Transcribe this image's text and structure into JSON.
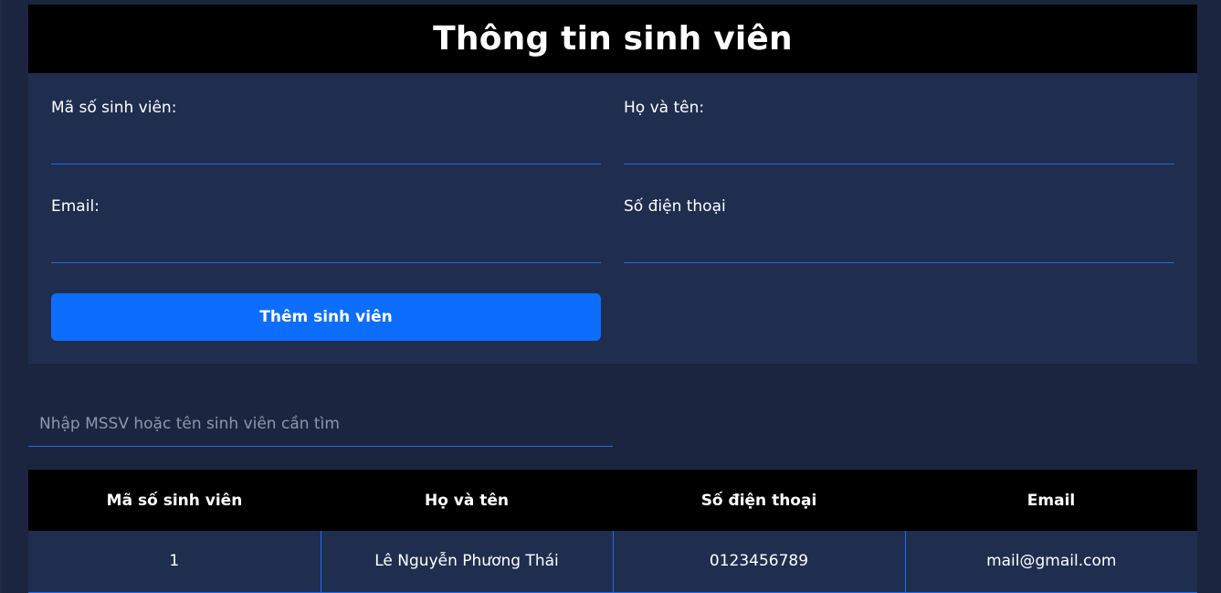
{
  "header": {
    "title": "Thông tin sinh viên"
  },
  "form": {
    "student_id_label": "Mã số sinh viên:",
    "student_id_value": "",
    "full_name_label": "Họ và tên:",
    "full_name_value": "",
    "email_label": "Email:",
    "email_value": "",
    "phone_label": "Số điện thoại",
    "phone_value": "",
    "add_button_label": "Thêm sinh viên"
  },
  "search": {
    "placeholder": "Nhập MSSV hoặc tên sinh viên cần tìm",
    "value": ""
  },
  "table": {
    "columns": [
      "Mã số sinh viên",
      "Họ và tên",
      "Số điện thoại",
      "Email"
    ],
    "rows": [
      [
        "1",
        "Lê Nguyễn Phương Thái",
        "0123456789",
        "mail@gmail.com"
      ]
    ]
  },
  "colors": {
    "background": "#1b2540",
    "panel": "#1f2e4f",
    "header_bg": "#000000",
    "accent": "#0d6efd",
    "border": "#1d6cf0"
  }
}
